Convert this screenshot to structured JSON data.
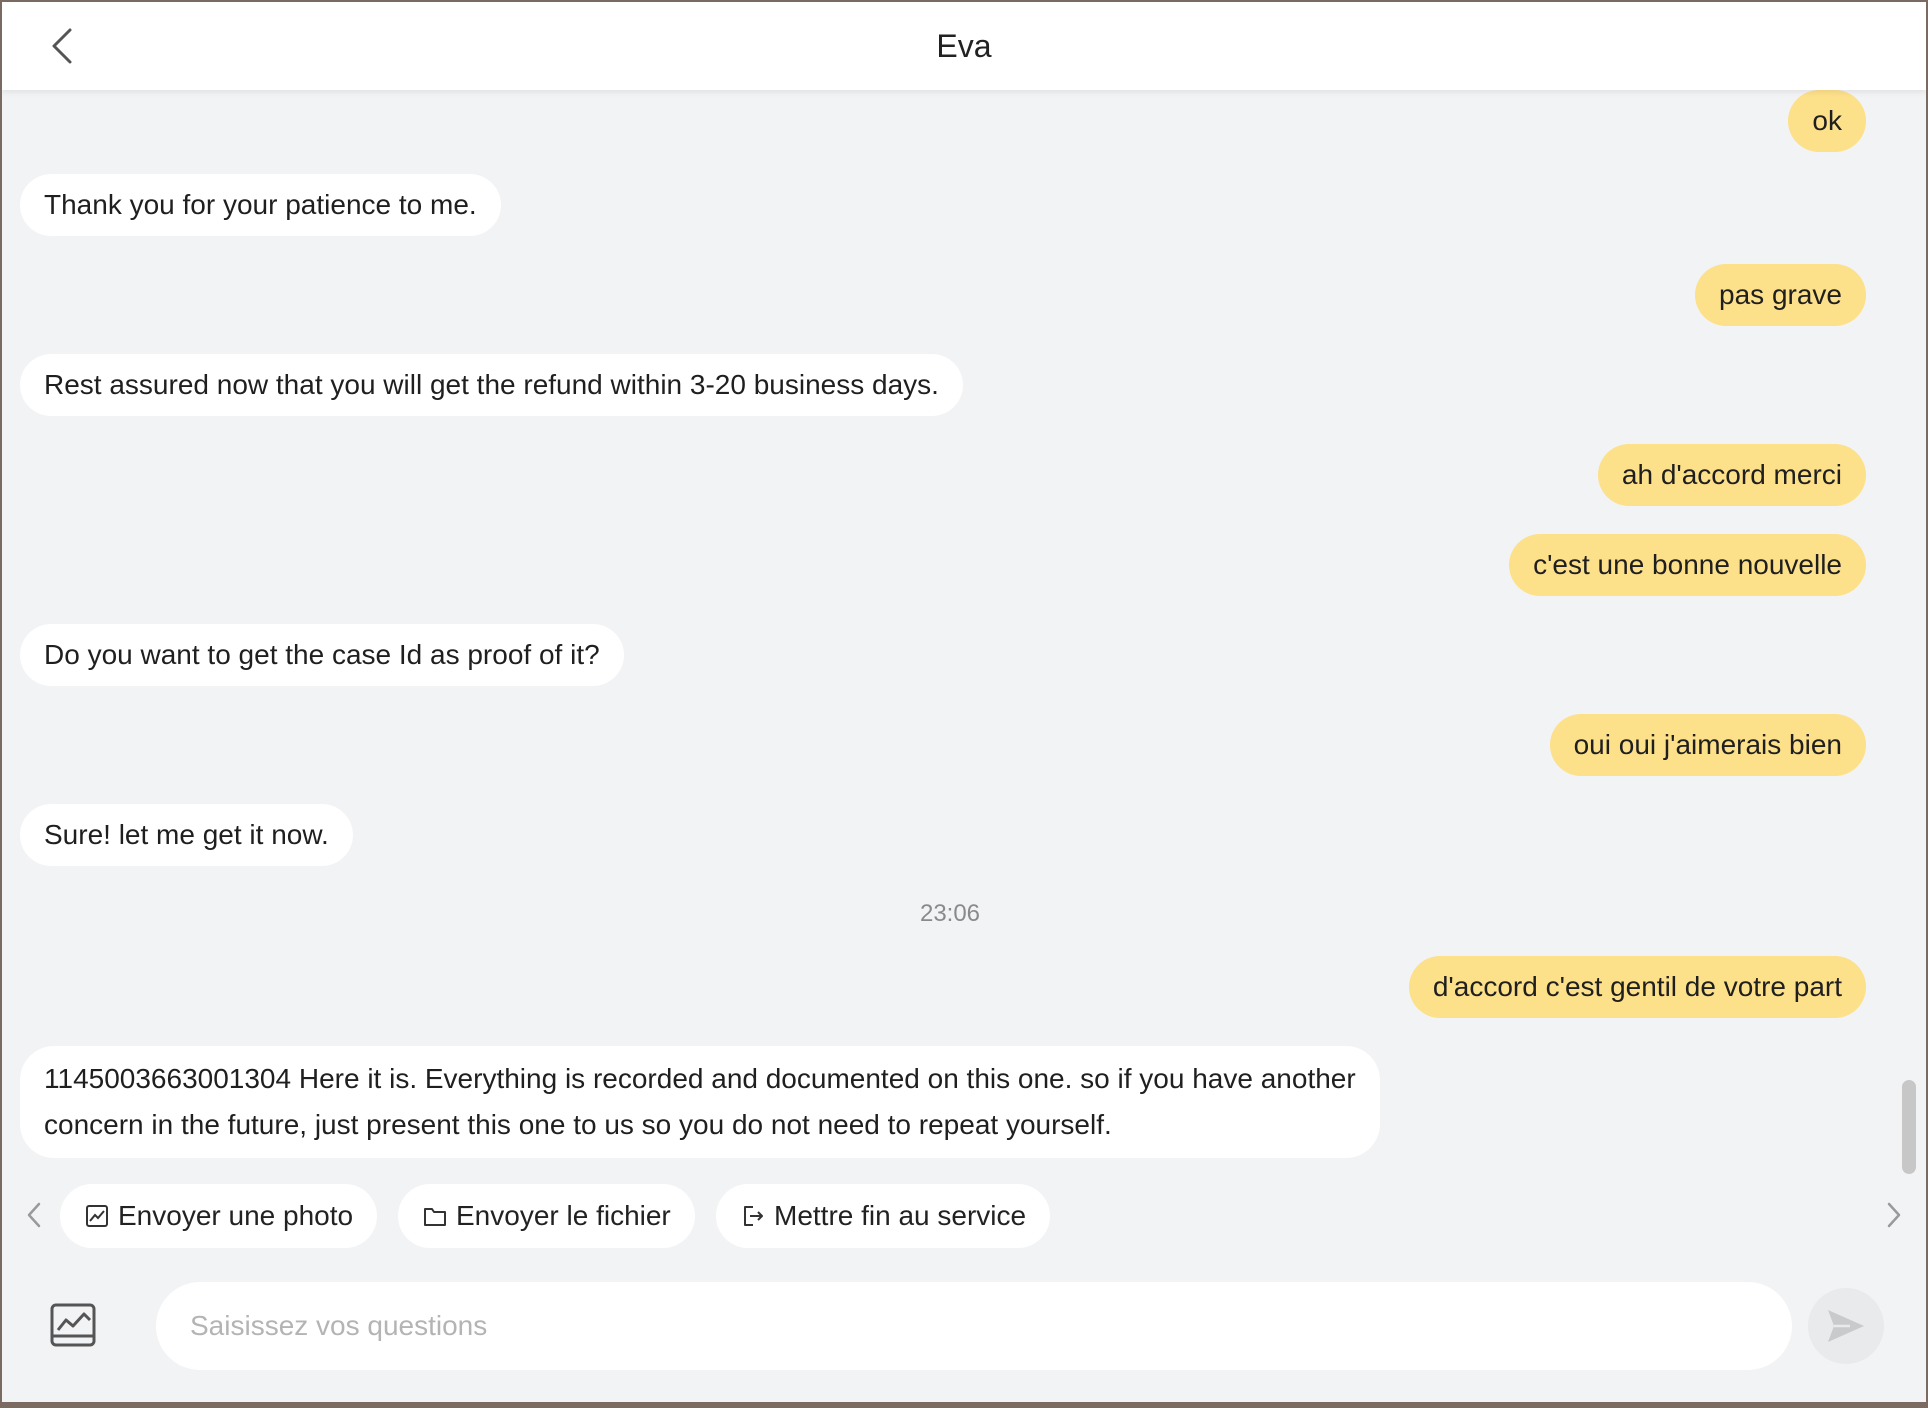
{
  "header": {
    "title": "Eva"
  },
  "messages": [
    {
      "side": "out",
      "text": "ok"
    },
    {
      "side": "in",
      "text": "Thank you for your patience to me."
    },
    {
      "side": "out",
      "text": "pas grave"
    },
    {
      "side": "in",
      "text": "Rest assured now that you will get the refund within 3-20 business days."
    },
    {
      "side": "out",
      "text": "ah d'accord merci"
    },
    {
      "side": "out",
      "text": "c'est une bonne nouvelle"
    },
    {
      "side": "in",
      "text": "Do you want to get the case Id as proof of it?"
    },
    {
      "side": "out",
      "text": "oui oui j'aimerais bien"
    },
    {
      "side": "in",
      "text": "Sure! let me get it now."
    },
    {
      "side": "time",
      "text": "23:06"
    },
    {
      "side": "out",
      "text": "d'accord c'est gentil de votre part"
    },
    {
      "side": "in",
      "text": "1145003663001304 Here it is.  Everything is recorded and documented on this one. so if you have another concern in the future, just present this one to us so you do not need to repeat yourself."
    }
  ],
  "quick_actions": [
    {
      "label": "Envoyer une photo",
      "icon": "image-icon"
    },
    {
      "label": "Envoyer le fichier",
      "icon": "folder-icon"
    },
    {
      "label": "Mettre fin au service",
      "icon": "exit-icon"
    }
  ],
  "composer": {
    "placeholder": "Saisissez vos questions"
  },
  "colors": {
    "incoming_bubble": "#ffffff",
    "outgoing_bubble": "#fde08a",
    "background": "#f2f3f5"
  }
}
